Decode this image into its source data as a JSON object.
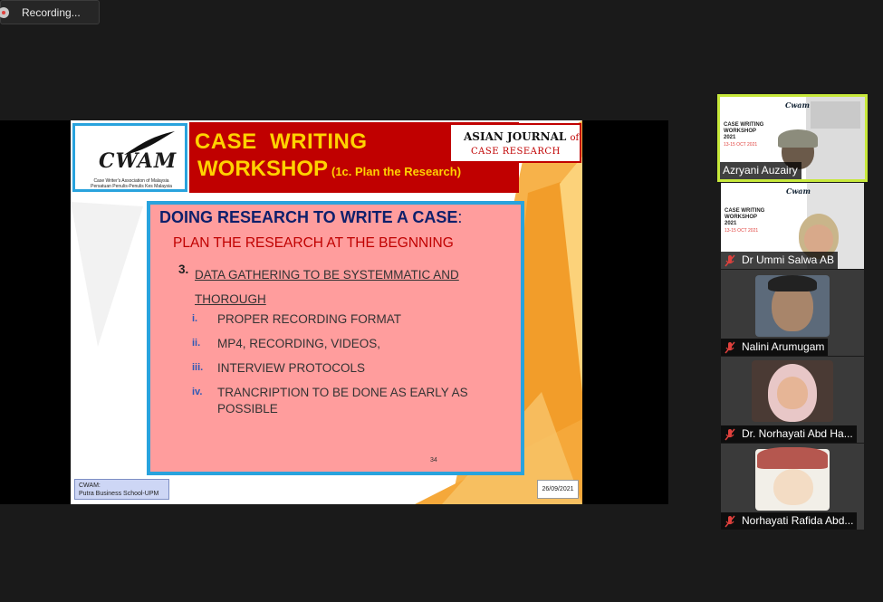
{
  "recording": {
    "label": "Recording..."
  },
  "slide": {
    "logo": {
      "name": "CWAM",
      "line1": "Case Writer's Association of Malaysia",
      "line2": "Persatuan Penulis-Penulis Kes Malaysia"
    },
    "title_line1": "CASE  WRITING",
    "title_line2": "WORKSHOP",
    "title_sub": "(1c. Plan the Research)",
    "journal": {
      "line1": "ASIAN JOURNAL",
      "of": "of",
      "line2": "CASE RESEARCH"
    },
    "heading": "DOING RESEARCH TO WRITE A CASE",
    "heading_colon": ":",
    "subheading": "PLAN THE RESEARCH AT THE BEGNNING",
    "point_number": "3.",
    "point_text": "DATA GATHERING TO BE SYSTEMMATIC AND THOROUGH",
    "items": [
      {
        "num": "i.",
        "text": "PROPER RECORDING FORMAT"
      },
      {
        "num": "ii.",
        "text": "MP4, RECORDING, VIDEOS,"
      },
      {
        "num": "iii.",
        "text": "INTERVIEW PROTOCOLS"
      },
      {
        "num": "iv.",
        "text": "TRANCRIPTION TO BE DONE AS EARLY AS POSSIBLE"
      }
    ],
    "page_number": "34",
    "footer_left_1": "CWAM:",
    "footer_left_2": "Putra Business School-UPM",
    "footer_date": "26/09/2021"
  },
  "participants": [
    {
      "name": "Azryani Auzairy",
      "active": true,
      "muted": false
    },
    {
      "name": "Dr Ummi Salwa AB",
      "active": false,
      "muted": true
    },
    {
      "name": "Nalini Arumugam",
      "active": false,
      "muted": true
    },
    {
      "name": "Dr. Norhayati Abd Ha...",
      "active": false,
      "muted": true
    },
    {
      "name": "Norhayati Rafida Abd...",
      "active": false,
      "muted": true
    }
  ],
  "tile_slide": {
    "title_line1": "CASE WRITING",
    "title_line2": "WORKSHOP",
    "title_line3": "2021",
    "date": "13-15 OCT 2021",
    "logo": "Cwam"
  },
  "colors": {
    "active_speaker_border": "#c7e83b",
    "slide_title_band": "#c00000",
    "content_box": "#ff9d9d",
    "accent_blue": "#29a3dd"
  },
  "icons": {
    "muted": "mic-off-icon",
    "recording": "record-icon"
  }
}
